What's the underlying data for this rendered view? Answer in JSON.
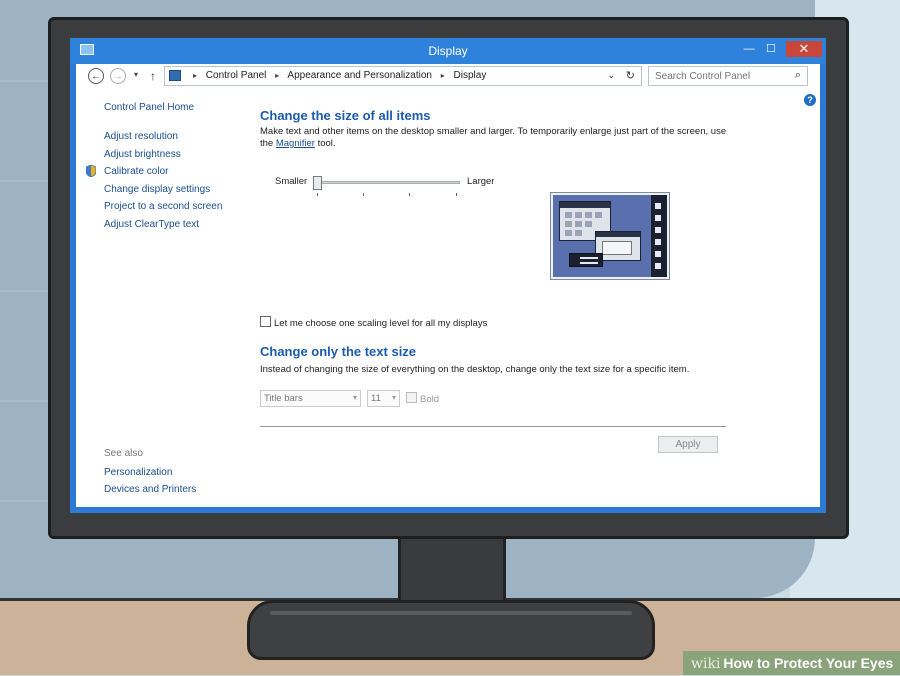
{
  "window": {
    "title": "Display"
  },
  "titlebar_buttons": {
    "minimize": "—",
    "maximize": "☐",
    "close": "✕"
  },
  "address": {
    "crumbs": [
      "Control Panel",
      "Appearance and Personalization",
      "Display"
    ],
    "search_placeholder": "Search Control Panel"
  },
  "sidebar": {
    "home": "Control Panel Home",
    "items": [
      {
        "label": "Adjust resolution"
      },
      {
        "label": "Adjust brightness"
      },
      {
        "label": "Calibrate color"
      },
      {
        "label": "Change display settings"
      },
      {
        "label": "Project to a second screen"
      },
      {
        "label": "Adjust ClearType text"
      }
    ],
    "see_also": {
      "header": "See also",
      "items": [
        {
          "label": "Personalization"
        },
        {
          "label": "Devices and Printers"
        }
      ]
    }
  },
  "main": {
    "size_heading": "Change the size of all items",
    "size_desc_before": "Make text and other items on the desktop smaller and larger. To temporarily enlarge just part of the screen, use the ",
    "magnifier_link": "Magnifier",
    "size_desc_after": " tool.",
    "slider": {
      "min_label": "Smaller",
      "max_label": "Larger",
      "value": 0
    },
    "scaling_checkbox": "Let me choose one scaling level for all my displays",
    "text_heading": "Change only the text size",
    "text_desc": "Instead of changing the size of everything on the desktop, change only the text size for a specific item.",
    "item_select": "Title bars",
    "size_select": "11",
    "bold_label": "Bold",
    "apply_button": "Apply"
  },
  "watermark": {
    "wiki": "wiki",
    "title": "How to Protect Your Eyes"
  },
  "colors": {
    "titlebar": "#2f82dc",
    "link": "#1a4f8f",
    "heading": "#1c5bad",
    "close": "#c9463b"
  }
}
